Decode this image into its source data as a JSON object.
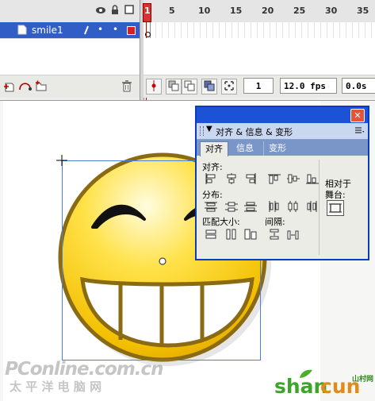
{
  "timeline": {
    "layer_name": "smile1",
    "frame_numbers": [
      "1",
      "5",
      "10",
      "15",
      "20",
      "25",
      "30",
      "35"
    ],
    "status": {
      "current_frame": "1",
      "frame_rate": "12.0 fps",
      "elapsed": "0.0s"
    }
  },
  "panel": {
    "title": "对齐 & 信息 & 变形",
    "tabs": [
      "对齐",
      "信息",
      "变形"
    ],
    "align_label": "对齐:",
    "distribute_label": "分布:",
    "match_size_label": "匹配大小:",
    "spacing_label": "间隔:",
    "to_stage_label_line1": "相对于",
    "to_stage_label_line2": "舞台:",
    "close_glyph": "✕"
  },
  "watermarks": {
    "pconline": "PConline.com.cn",
    "pconline_cn": "太 平 洋 电 脑 网",
    "shancun_a": "shan",
    "shancun_b": "cun",
    "shancun_net": "山村网"
  },
  "colors": {
    "selection_blue": "#315ec6",
    "panel_title_blue": "#1c52d6",
    "playhead_red": "#cc0000",
    "smiley_yellow": "#ffd400",
    "smiley_outline": "#8a6a12"
  }
}
